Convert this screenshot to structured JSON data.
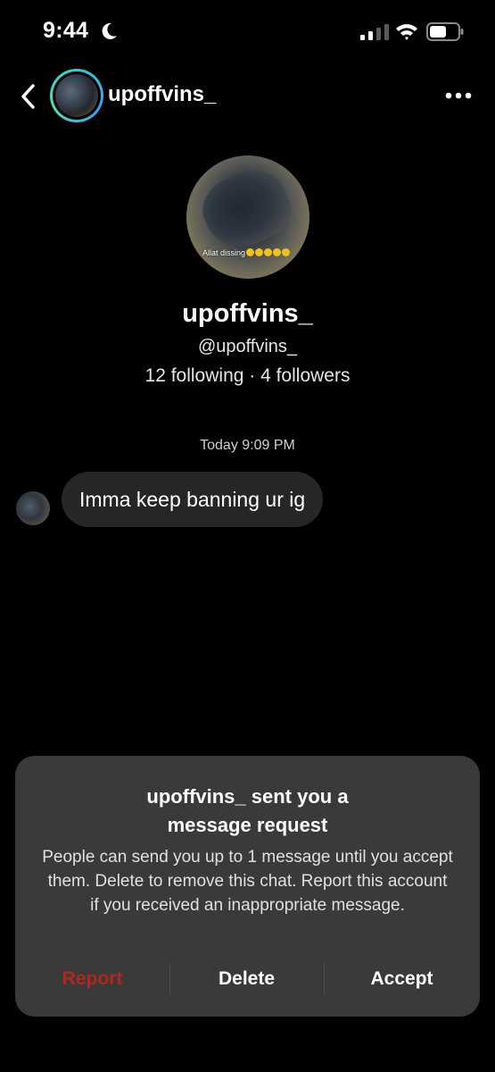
{
  "status_bar": {
    "time": "9:44",
    "icons": [
      "moon-icon",
      "signal-icon",
      "wifi-icon",
      "battery-icon"
    ]
  },
  "header": {
    "back_icon": "chevron-left-icon",
    "username": "upoffvins_",
    "more_icon": "more-horizontal-icon"
  },
  "profile": {
    "avatar_caption": "Allat dissing",
    "name": "upoffvins_",
    "handle": "@upoffvins_",
    "stats": "12 following · 4 followers"
  },
  "conversation": {
    "timestamp": "Today 9:09 PM",
    "messages": [
      {
        "from": "upoffvins_",
        "text": "Imma keep banning ur ig"
      }
    ]
  },
  "request": {
    "title_line1": "upoffvins_ sent you a",
    "title_line2": "message request",
    "body": "People can send you up to 1 message until you accept them. Delete to remove this chat. Report this account if you received an inappropriate message.",
    "report_label": "Report",
    "delete_label": "Delete",
    "accept_label": "Accept"
  },
  "colors": {
    "background": "#000000",
    "bubble": "#262626",
    "sheet": "#3a3a3a",
    "report": "#b3261e",
    "story_ring": "#2fd1d8"
  }
}
